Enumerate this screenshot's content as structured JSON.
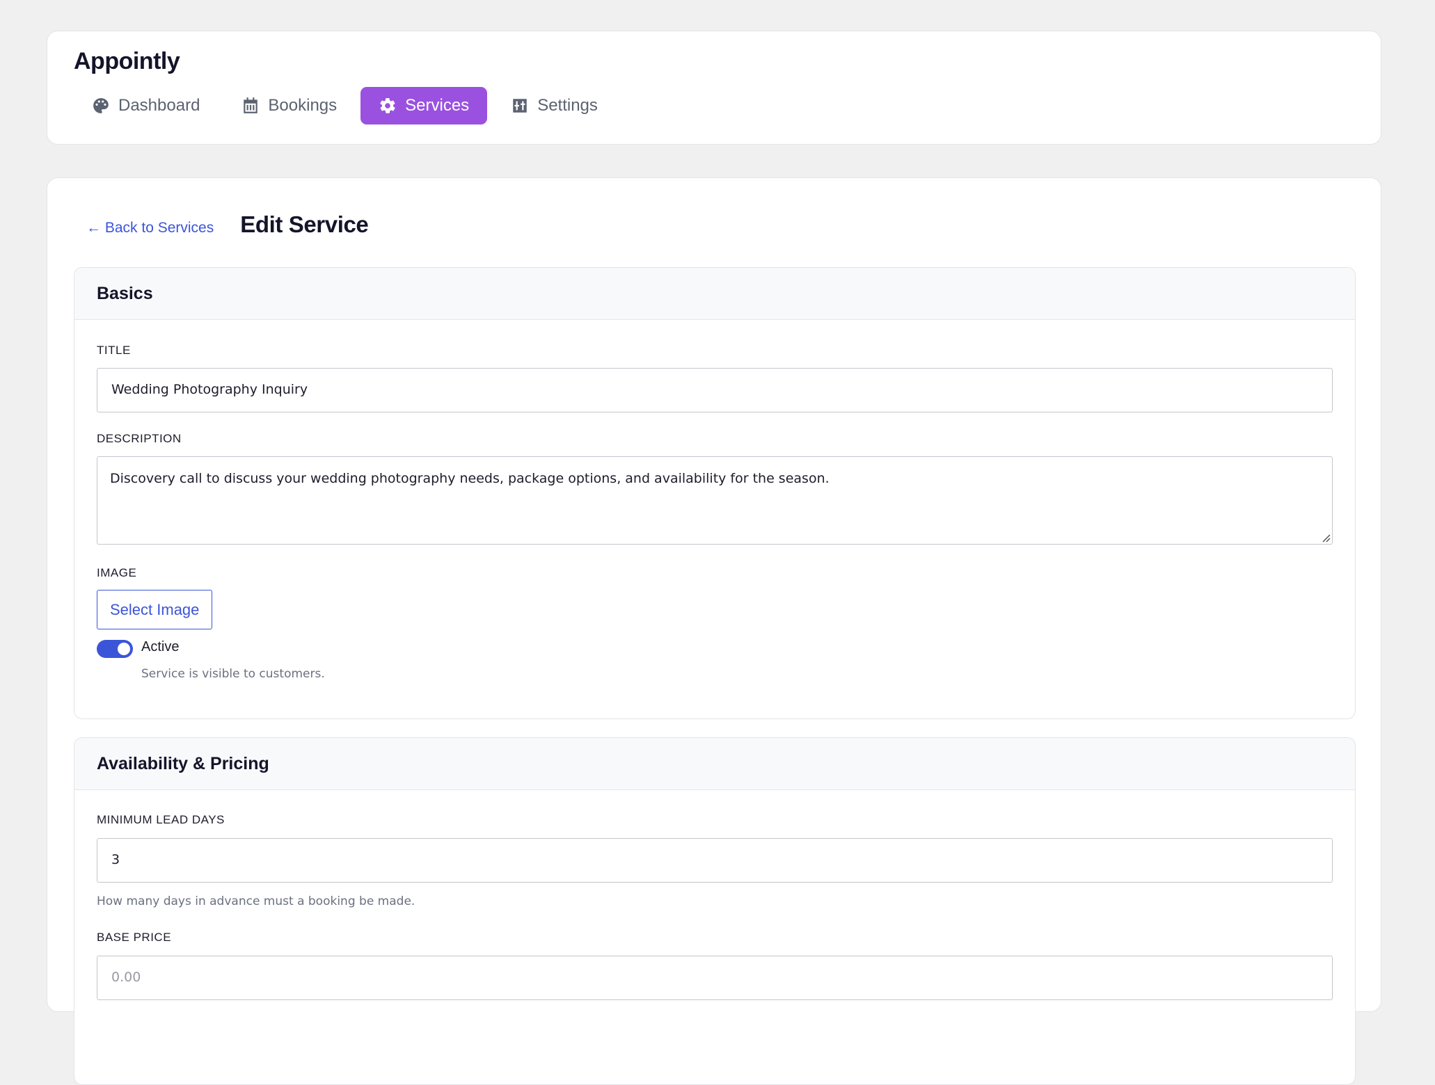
{
  "app": {
    "title": "Appointly"
  },
  "nav": {
    "items": [
      {
        "label": "Dashboard",
        "icon": "palette-icon",
        "active": false
      },
      {
        "label": "Bookings",
        "icon": "calendar-icon",
        "active": false
      },
      {
        "label": "Services",
        "icon": "gear-icon",
        "active": true
      },
      {
        "label": "Settings",
        "icon": "sliders-icon",
        "active": false
      }
    ],
    "active_color": "#9b51e0"
  },
  "page": {
    "back_link": "← Back to Services",
    "title": "Edit Service"
  },
  "basics": {
    "heading": "Basics",
    "title_label": "TITLE",
    "title_value": "Wedding Photography Inquiry",
    "description_label": "DESCRIPTION",
    "description_value": "Discovery call to discuss your wedding photography needs, package options, and availability for the season.",
    "image_label": "IMAGE",
    "select_image": "Select Image",
    "active_label": "Active",
    "active_on": true,
    "active_help": "Service is visible to customers."
  },
  "availability": {
    "heading": "Availability & Pricing",
    "lead_days_label": "MINIMUM LEAD DAYS",
    "lead_days_value": "3",
    "lead_days_help": "How many days in advance must a booking be made.",
    "base_price_label": "BASE PRICE",
    "base_price_value": "0.00"
  },
  "colors": {
    "accent": "#3b55d9",
    "brand": "#9b51e0"
  }
}
